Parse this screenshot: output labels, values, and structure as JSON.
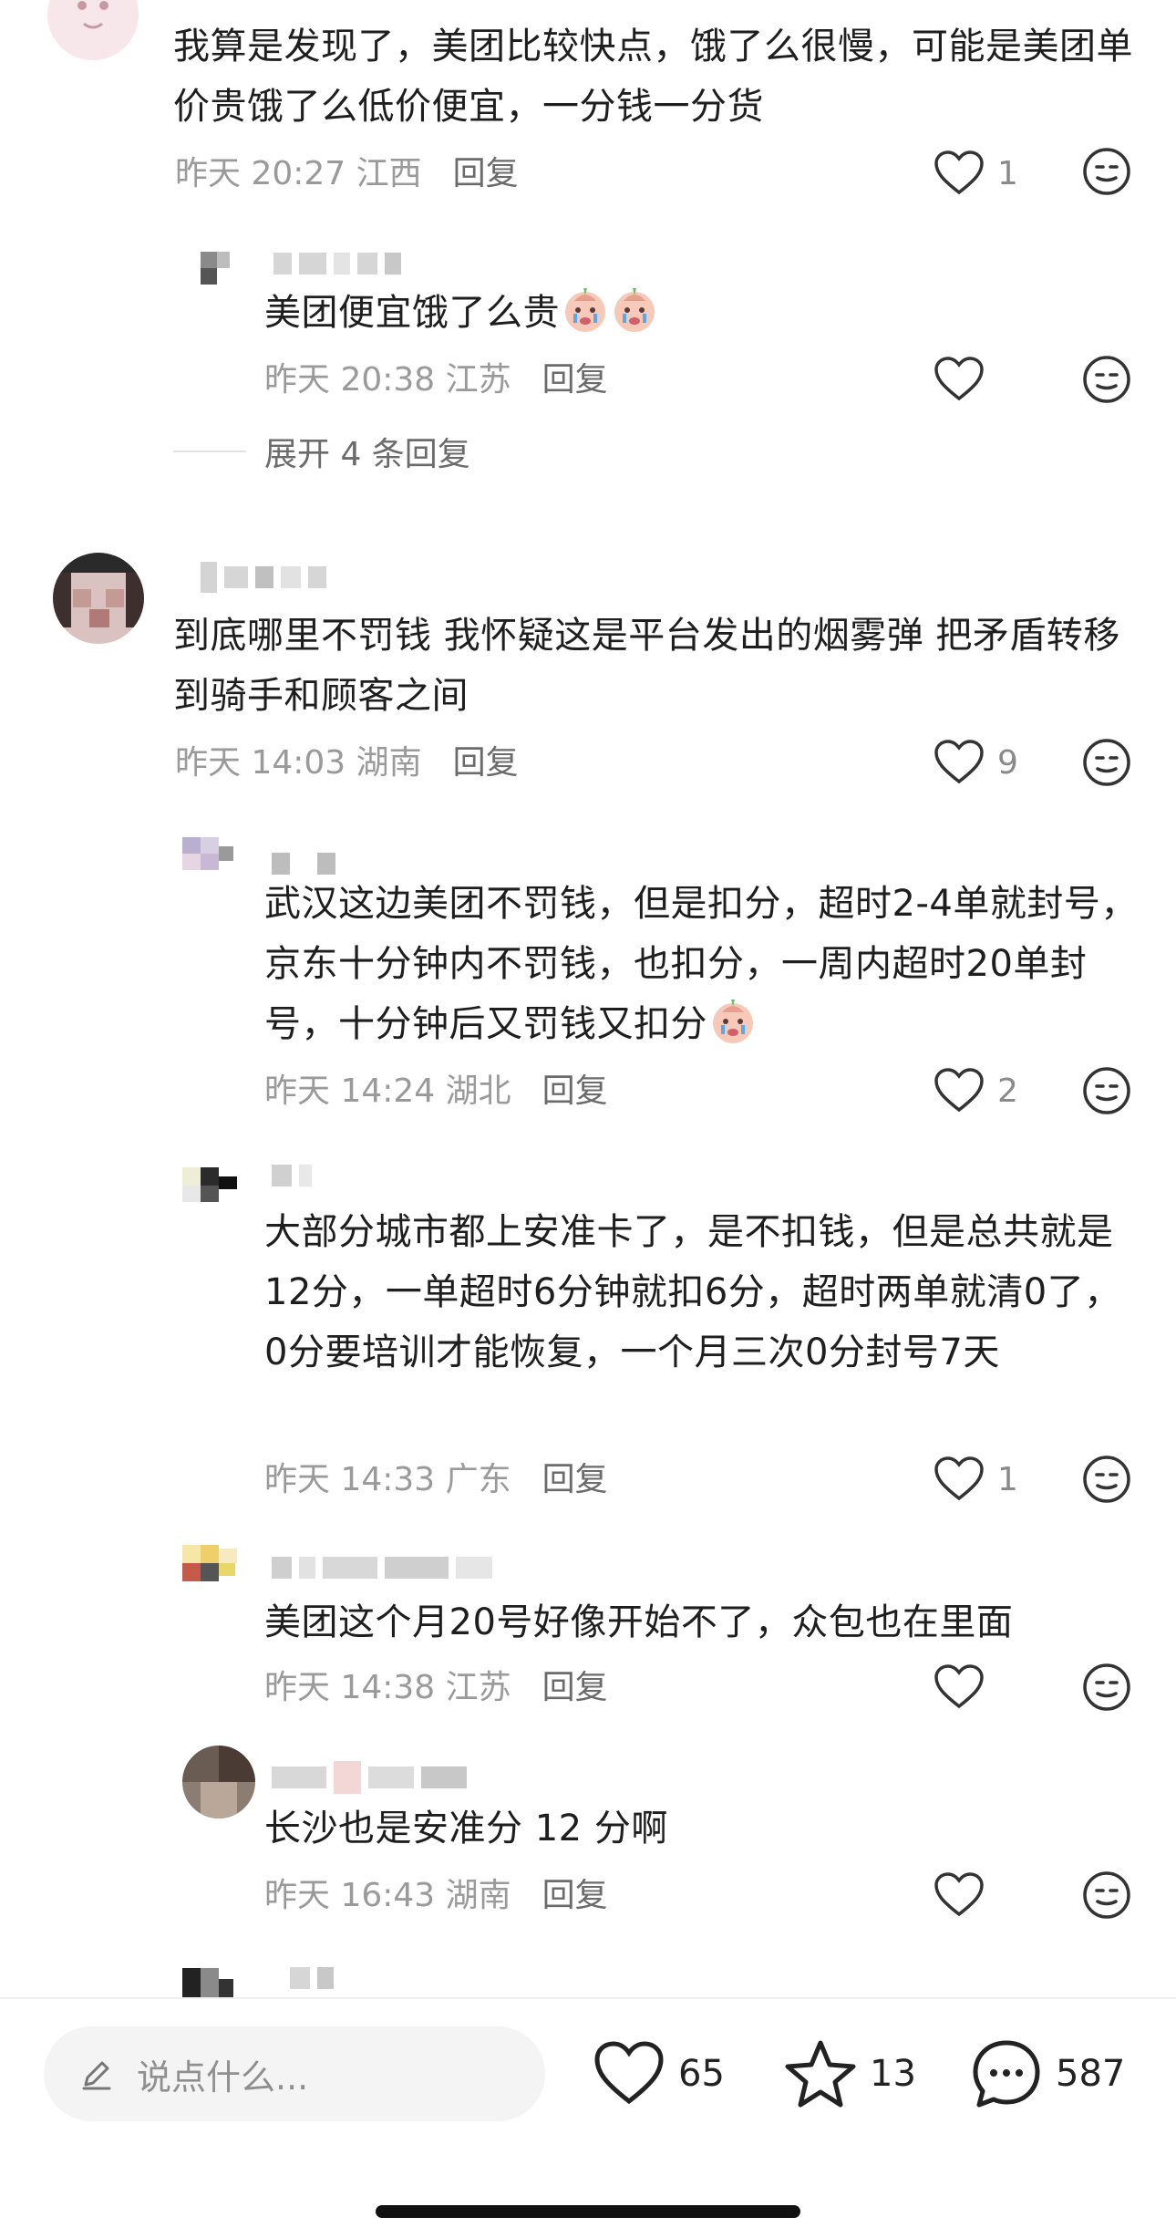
{
  "comments": [
    {
      "text": "我算是发现了，美团比较快点，饿了么很慢，可能是美团单价贵饿了么低价便宜，一分钱一分货",
      "time": "昨天 20:27",
      "location": "江西",
      "reply_label": "回复",
      "likes": "1"
    },
    {
      "text": "美团便宜饿了么贵",
      "time": "昨天 20:38",
      "location": "江苏",
      "reply_label": "回复",
      "likes": ""
    },
    {
      "text": "到底哪里不罚钱 我怀疑这是平台发出的烟雾弹 把矛盾转移到骑手和顾客之间",
      "time": "昨天 14:03",
      "location": "湖南",
      "reply_label": "回复",
      "likes": "9"
    },
    {
      "text": "武汉这边美团不罚钱，但是扣分，超时2-4单就封号，京东十分钟内不罚钱，也扣分，一周内超时20单封号，十分钟后又罚钱又扣分",
      "time": "昨天 14:24",
      "location": "湖北",
      "reply_label": "回复",
      "likes": "2"
    },
    {
      "text": "大部分城市都上安准卡了，是不扣钱，但是总共就是12分，一单超时6分钟就扣6分，超时两单就清0了，0分要培训才能恢复，一个月三次0分封号7天",
      "time": "昨天 14:33",
      "location": "广东",
      "reply_label": "回复",
      "likes": "1"
    },
    {
      "text": "美团这个月20号好像开始不了，众包也在里面",
      "time": "昨天 14:38",
      "location": "江苏",
      "reply_label": "回复",
      "likes": ""
    },
    {
      "text": "长沙也是安准分 12 分啊",
      "time": "昨天 16:43",
      "location": "湖南",
      "reply_label": "回复",
      "likes": ""
    }
  ],
  "expand_replies": "展开 4 条回复",
  "bottom_bar": {
    "input_placeholder": "说点什么...",
    "likes": "65",
    "favorites": "13",
    "comments": "587"
  },
  "icons": [
    "heart-icon",
    "react-icon",
    "crying-emoji-icon",
    "pencil-icon",
    "star-icon",
    "comment-bubble-icon"
  ]
}
